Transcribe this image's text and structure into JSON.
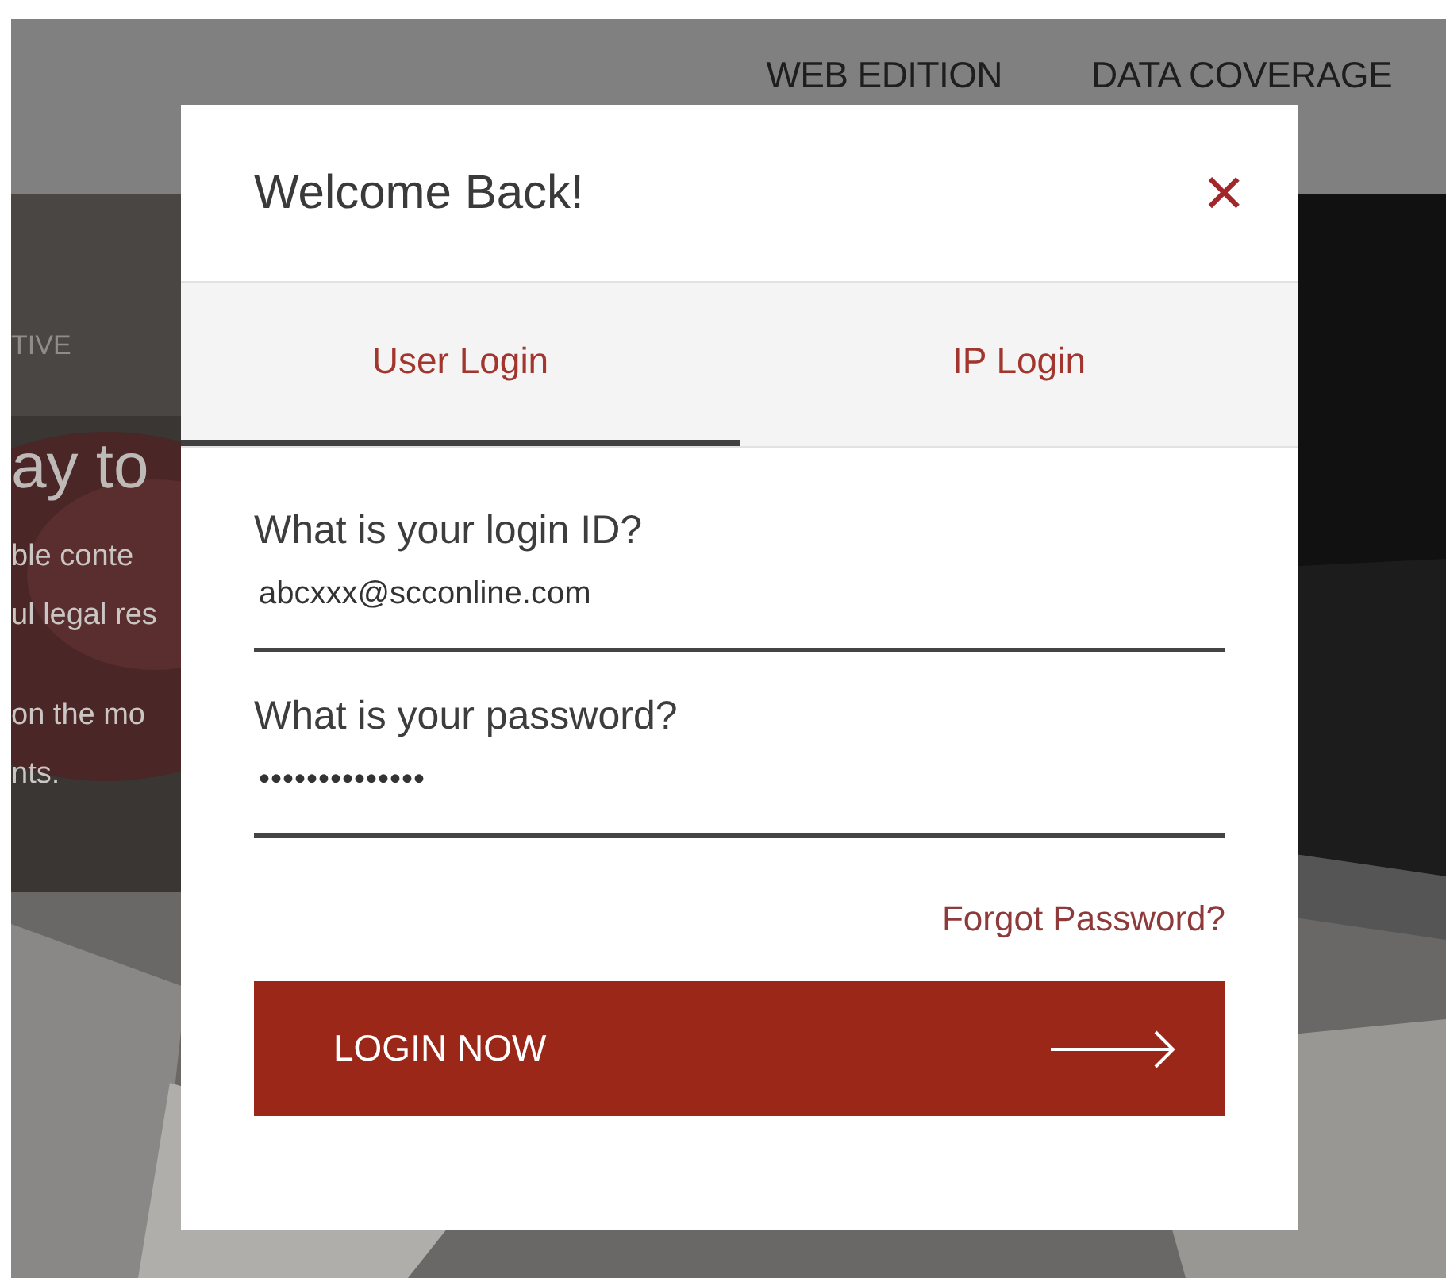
{
  "nav": {
    "links": [
      "WEB EDITION",
      "DATA COVERAGE"
    ]
  },
  "hero": {
    "kicker": "TIVE",
    "heading": "ay to",
    "paragraphs": [
      [
        "ble conte",
        "ul legal res"
      ],
      [
        "on the mo",
        "nts."
      ]
    ]
  },
  "dialog": {
    "title": "Welcome Back!",
    "close": "×",
    "tabs": [
      {
        "label": "User Login",
        "selected": true
      },
      {
        "label": "IP Login",
        "selected": false
      }
    ],
    "fields": [
      {
        "label": "What is your login ID?",
        "value": "abcxxx@scconline.com",
        "kind": "text"
      },
      {
        "label": "What is your password?",
        "value": "••••••••••••••",
        "kind": "password"
      }
    ],
    "forgot_link": "Forgot Password?",
    "submit": "LOGIN NOW"
  }
}
